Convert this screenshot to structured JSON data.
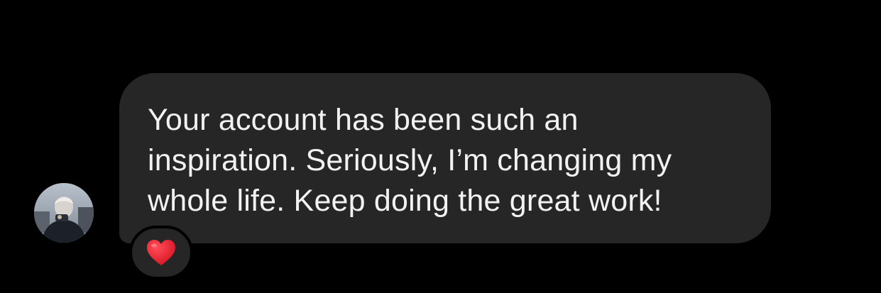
{
  "thread": {
    "message": {
      "text": "Your account has been such an\ninspiration. Seriously, I’m changing my\nwhole life. Keep doing the great work!"
    },
    "reaction": {
      "icon": "red-heart-icon",
      "color": "#e5192d"
    }
  },
  "colors": {
    "background": "#000000",
    "bubble": "#262626",
    "text": "#f2f2f2"
  }
}
